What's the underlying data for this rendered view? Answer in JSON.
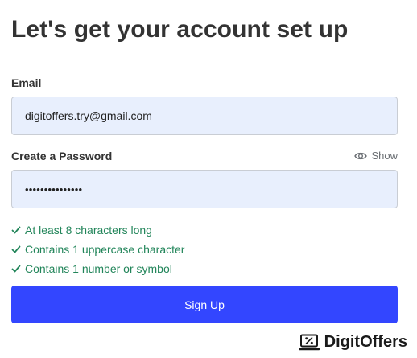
{
  "page": {
    "title": "Let's get your account set up"
  },
  "form": {
    "email": {
      "label": "Email",
      "value": "digitoffers.try@gmail.com"
    },
    "password": {
      "label": "Create a Password",
      "masked_value": "•••••••••••••••",
      "show_label": "Show"
    },
    "requirements": [
      {
        "text": "At least 8 characters long",
        "met": true
      },
      {
        "text": "Contains 1 uppercase character",
        "met": true
      },
      {
        "text": "Contains 1 number or symbol",
        "met": true
      }
    ],
    "submit_label": "Sign Up"
  },
  "brand": {
    "name": "DigitOffers",
    "logo_icon": "percent-laptop-icon"
  },
  "colors": {
    "accent": "#3346ff",
    "input_bg": "#e8effd",
    "success": "#22855a",
    "text": "#333333"
  }
}
